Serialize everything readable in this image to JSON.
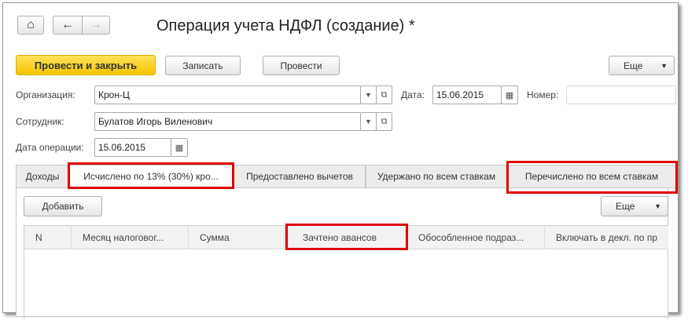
{
  "title": "Операция учета НДФЛ (создание) *",
  "nav": {
    "home": "⌂",
    "back": "←",
    "forward": "→"
  },
  "toolbar": {
    "post_close": "Провести и закрыть",
    "save": "Записать",
    "post": "Провести",
    "more": "Еще"
  },
  "form": {
    "org_label": "Организация:",
    "org_value": "Крон-Ц",
    "date_label": "Дата:",
    "date_value": "15.06.2015",
    "number_label": "Номер:",
    "number_value": "",
    "employee_label": "Сотрудник:",
    "employee_value": "Булатов Игорь Виленович",
    "op_date_label": "Дата операции:",
    "op_date_value": "15.06.2015"
  },
  "tabs": [
    "Доходы",
    "Исчислено по 13% (30%) кро...",
    "Предоставлено вычетов",
    "Удержано по всем ставкам",
    "Перечислено по всем ставкам"
  ],
  "table_toolbar": {
    "add": "Добавить",
    "more": "Еще"
  },
  "columns": [
    "N",
    "Месяц налоговог...",
    "Сумма",
    "Зачтено авансов",
    "Обособленное подраз...",
    "Включать в декл. по пр"
  ]
}
